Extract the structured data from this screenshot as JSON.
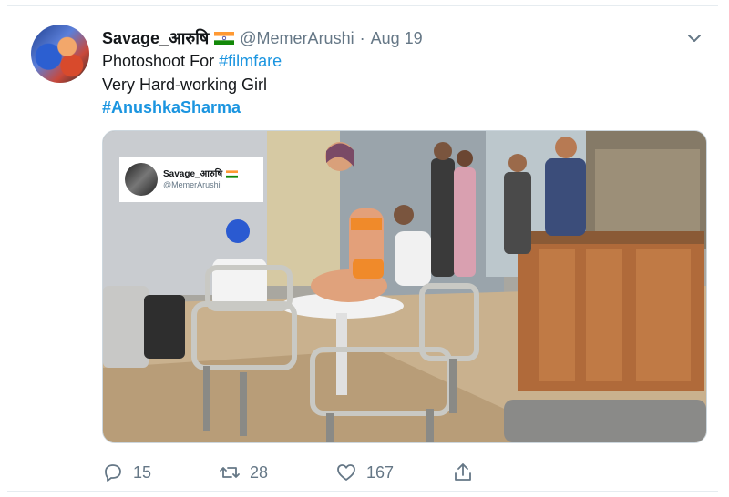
{
  "tweet": {
    "display_name": "Savage_आरुषि",
    "handle": "@MemerArushi",
    "separator": "·",
    "date": "Aug 19",
    "line1_prefix": "Photoshoot For ",
    "line1_hashtag": "#filmfare",
    "line2": "Very Hard-working Girl",
    "line3_hashtag": "#AnushkaSharma"
  },
  "media": {
    "overlay_name": "Savage_आरुषि",
    "overlay_handle": "@MemerArushi"
  },
  "actions": {
    "replies": "15",
    "retweets": "28",
    "likes": "167"
  },
  "icons": {
    "reply": "reply-icon",
    "retweet": "retweet-icon",
    "like": "heart-icon",
    "share": "share-icon",
    "more": "chevron-down-icon"
  },
  "colors": {
    "link": "#1b95e0",
    "muted": "#657786"
  }
}
